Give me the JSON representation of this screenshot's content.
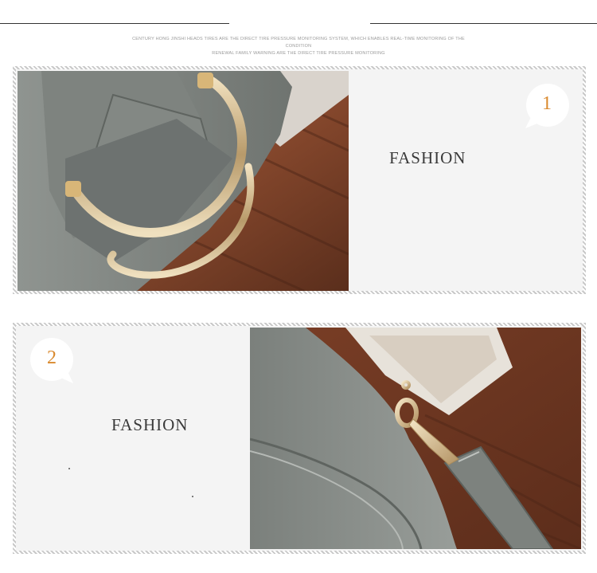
{
  "header": {
    "tagline_line1": "Century Hong Jinshi Heads tires are the direct tire pressure monitoring system, which enables real-time monitoring of the condition",
    "tagline_line2": "renewal family warning are the direct tire pressure monitoring"
  },
  "panels": [
    {
      "number": "1",
      "label": "FASHION",
      "photo": "handbag-metal-handle-photo"
    },
    {
      "number": "2",
      "label": "FASHION",
      "photo": "handbag-strap-clasp-photo"
    }
  ],
  "colors": {
    "accent_number": "#d9892d",
    "panel_bg": "#f4f4f4",
    "text_dark": "#3a3a3a"
  }
}
